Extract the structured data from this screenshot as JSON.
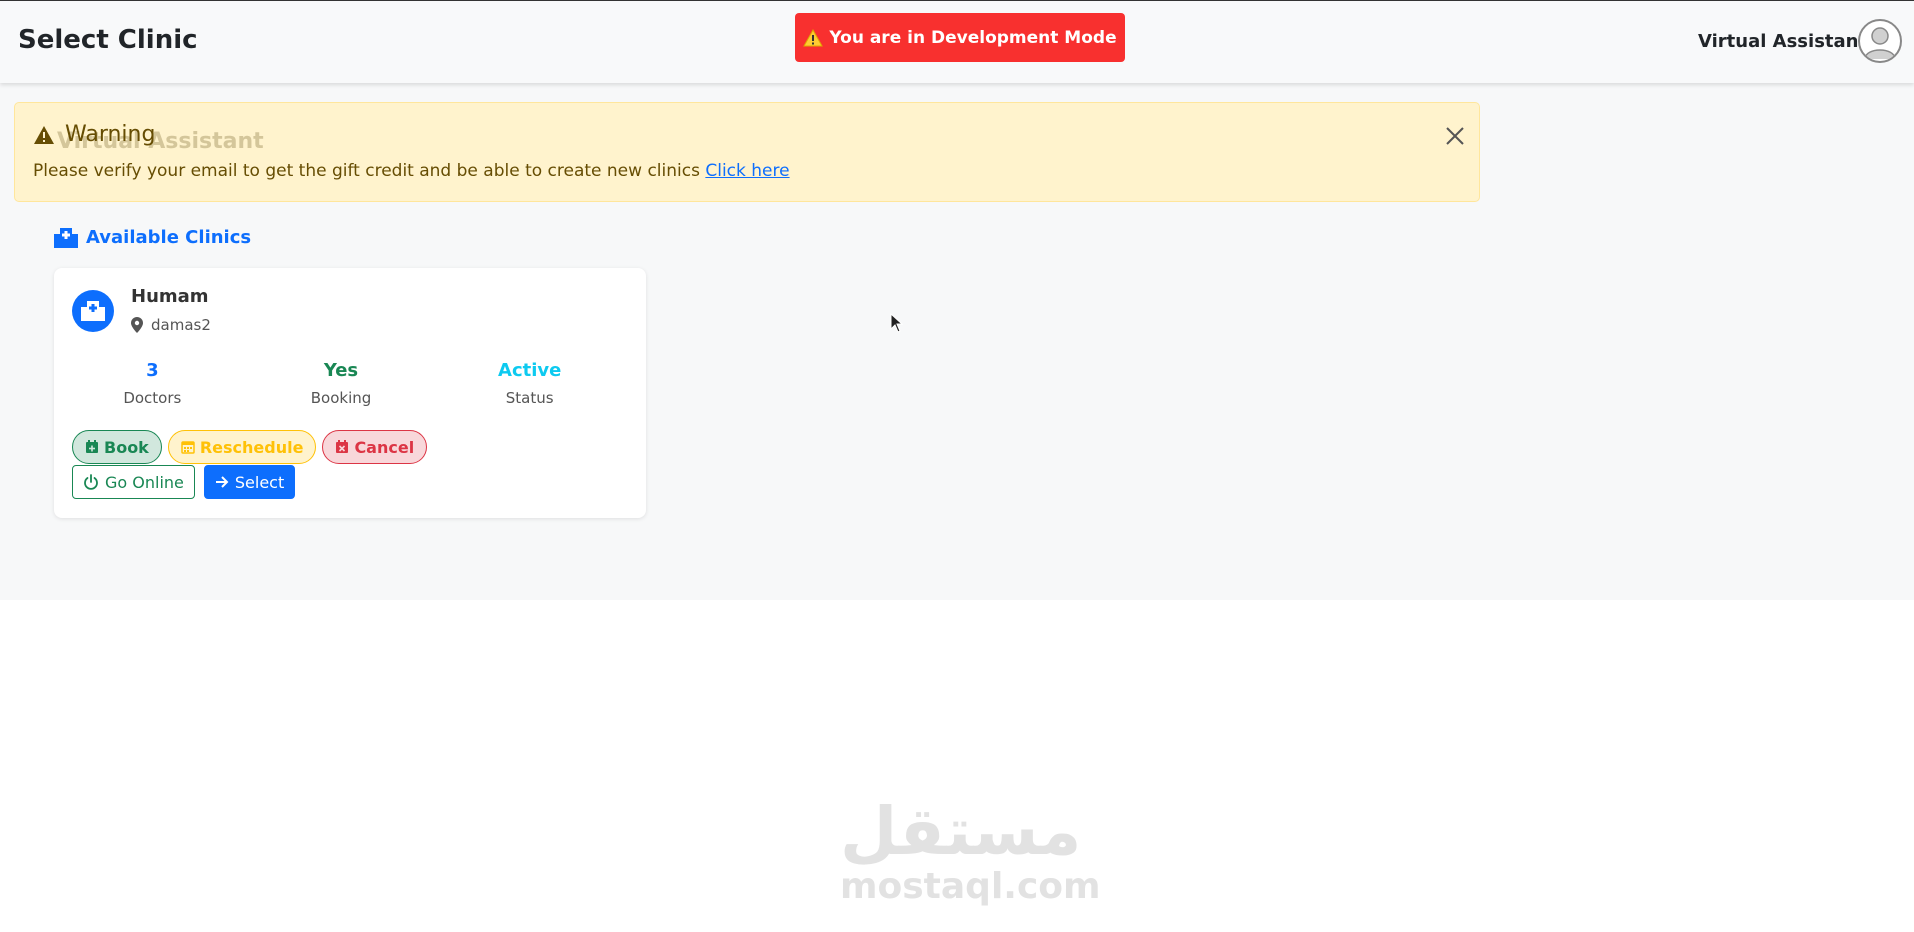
{
  "header": {
    "title": "Select Clinic",
    "dev_mode_banner": "You are in Development Mode",
    "user_name": "Virtual Assistant"
  },
  "alert": {
    "ghost_text": "Virtual Assistant",
    "heading": "Warning",
    "message": "Please verify your email to get the gift credit and be able to create new clinics",
    "link_text": "Click here"
  },
  "section": {
    "title": "Available Clinics"
  },
  "clinic": {
    "name": "Humam",
    "location": "damas2",
    "stats": [
      {
        "value": "3",
        "label": "Doctors",
        "color": "#0d6efd"
      },
      {
        "value": "Yes",
        "label": "Booking",
        "color": "#198754"
      },
      {
        "value": "Active",
        "label": "Status",
        "color": "#0dcaf0"
      }
    ],
    "actions": {
      "book": "Book",
      "reschedule": "Reschedule",
      "cancel": "Cancel",
      "go_online": "Go Online",
      "select": "Select"
    }
  },
  "watermark": {
    "arabic": "مستقل",
    "latin": "mostaql.com"
  },
  "colors": {
    "primary": "#0d6efd",
    "success": "#198754",
    "warning": "#ffc107",
    "danger": "#dc3545",
    "info": "#0dcaf0",
    "dev_banner": "#f8302f"
  }
}
